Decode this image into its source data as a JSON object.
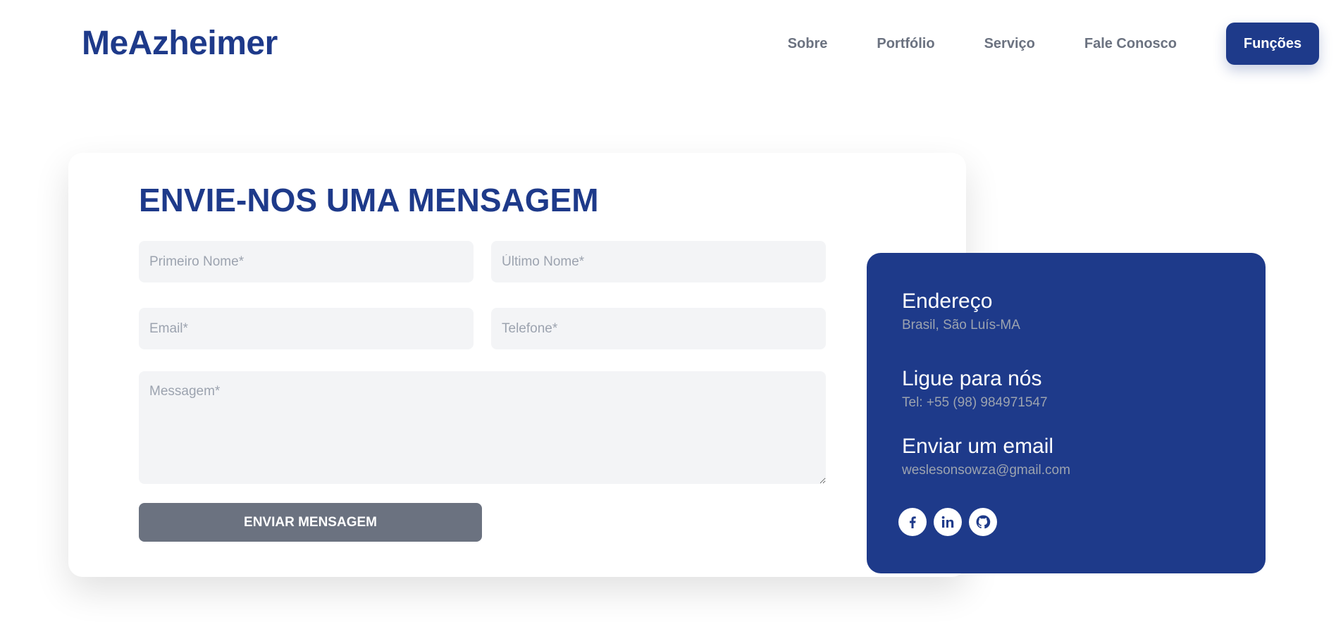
{
  "header": {
    "logo": "MeAzheimer",
    "nav": [
      "Sobre",
      "Portfólio",
      "Serviço",
      "Fale Conosco"
    ],
    "cta_label": "Funções"
  },
  "form": {
    "title": "ENVIE-NOS UMA MENSAGEM",
    "first_name_placeholder": "Primeiro Nome*",
    "last_name_placeholder": "Último Nome*",
    "email_placeholder": "Email*",
    "phone_placeholder": "Telefone*",
    "message_placeholder": "Messagem*",
    "submit_label": "ENVIAR MENSAGEM"
  },
  "contact": {
    "address_title": "Endereço",
    "address_value": "Brasil, São Luís-MA",
    "phone_title": "Ligue para nós",
    "phone_value": "Tel: +55 (98) 984971547",
    "email_title": "Enviar um email",
    "email_value": "weslesonsowza@gmail.com",
    "socials": [
      "facebook-icon",
      "linkedin-icon",
      "github-icon"
    ]
  },
  "colors": {
    "brand": "#1e3a8a",
    "button_gray": "#6b7280",
    "field_bg": "#f3f4f6",
    "muted_text": "#9ca3af"
  }
}
